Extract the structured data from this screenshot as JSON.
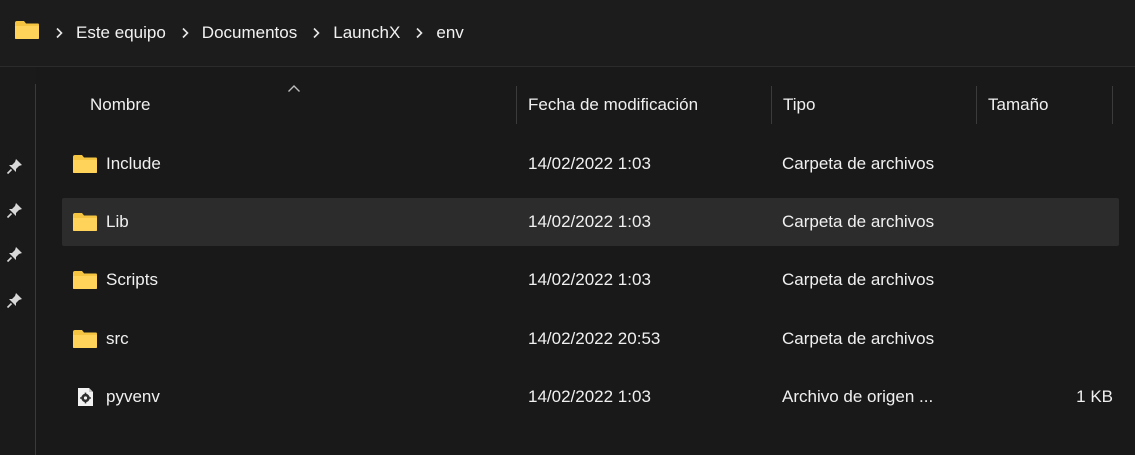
{
  "breadcrumb": {
    "items": [
      "Este equipo",
      "Documentos",
      "LaunchX",
      "env"
    ]
  },
  "columns": {
    "name": "Nombre",
    "date": "Fecha de modificación",
    "type": "Tipo",
    "size": "Tamaño"
  },
  "files": [
    {
      "name": "Include",
      "date": "14/02/2022 1:03",
      "type": "Carpeta de archivos",
      "size": "",
      "icon": "folder-icon"
    },
    {
      "name": "Lib",
      "date": "14/02/2022 1:03",
      "type": "Carpeta de archivos",
      "size": "",
      "icon": "folder-icon"
    },
    {
      "name": "Scripts",
      "date": "14/02/2022 1:03",
      "type": "Carpeta de archivos",
      "size": "",
      "icon": "folder-icon"
    },
    {
      "name": "src",
      "date": "14/02/2022 20:53",
      "type": "Carpeta de archivos",
      "size": "",
      "icon": "folder-icon"
    },
    {
      "name": "pyvenv",
      "date": "14/02/2022 1:03",
      "type": "Archivo de origen ...",
      "size": "1 KB",
      "icon": "config-file-icon"
    }
  ],
  "colors": {
    "folder": "#f5c542",
    "background": "#191919",
    "selected_row": "#2c2c2c"
  }
}
